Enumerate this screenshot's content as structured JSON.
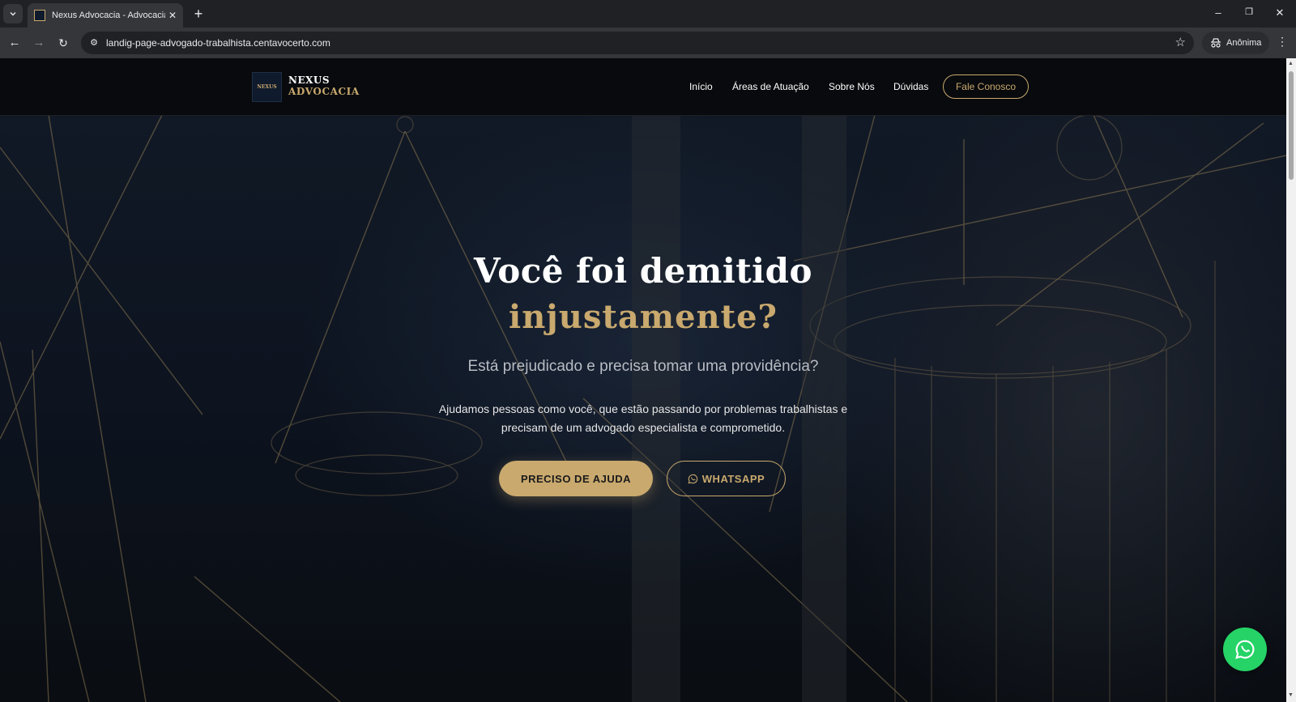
{
  "browser": {
    "tab_title": "Nexus Advocacia - Advocacia Tr",
    "url": "landig-page-advogado-trabalhista.centavocerto.com",
    "profile_label": "Anônima"
  },
  "header": {
    "logo_mark": "NEXUS",
    "logo_name": "NEXUS",
    "logo_sub": "ADVOCACIA",
    "nav": [
      "Início",
      "Áreas de Atuação",
      "Sobre Nós",
      "Dúvidas"
    ],
    "cta": "Fale Conosco"
  },
  "hero": {
    "title_line1": "Você foi demitido",
    "title_line2": "injustamente?",
    "subtitle": "Está prejudicado e precisa tomar uma providência?",
    "description": "Ajudamos pessoas como você, que estão passando por problemas trabalhistas e precisam de um advogado especialista e comprometido.",
    "primary_button": "PRECISO DE AJUDA",
    "secondary_button": "WHATSAPP"
  },
  "colors": {
    "accent_gold": "#c9a96e",
    "whatsapp_green": "#25d366"
  }
}
